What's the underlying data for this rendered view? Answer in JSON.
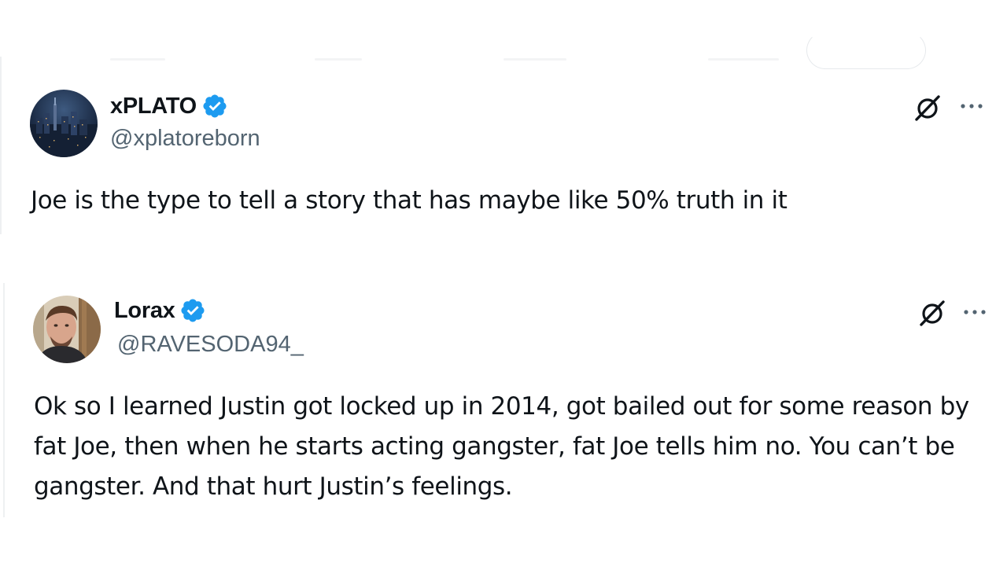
{
  "posts": [
    {
      "display_name": "xPLATO",
      "handle": "@xplatoreborn",
      "verified": true,
      "text": "Joe is the type to tell a story that has maybe like 50% truth in it",
      "avatar": "city-night-skyline-avatar"
    },
    {
      "display_name": "Lorax",
      "handle": "@RAVESODA94_",
      "verified": true,
      "text": "Ok so I learned Justin got locked up in 2014, got bailed out for some reason by fat Joe, then when he starts acting gangster, fat Joe tells him no. You can’t be gangster. And that hurt Justin’s feelings.",
      "avatar": "man-portrait-avatar"
    }
  ],
  "icons": {
    "verified": "verified-badge-icon",
    "grok": "grok-icon",
    "more": "more-options-icon"
  },
  "colors": {
    "verified_blue": "#1d9bf0",
    "text_primary": "#0f1419",
    "text_secondary": "#536471"
  }
}
